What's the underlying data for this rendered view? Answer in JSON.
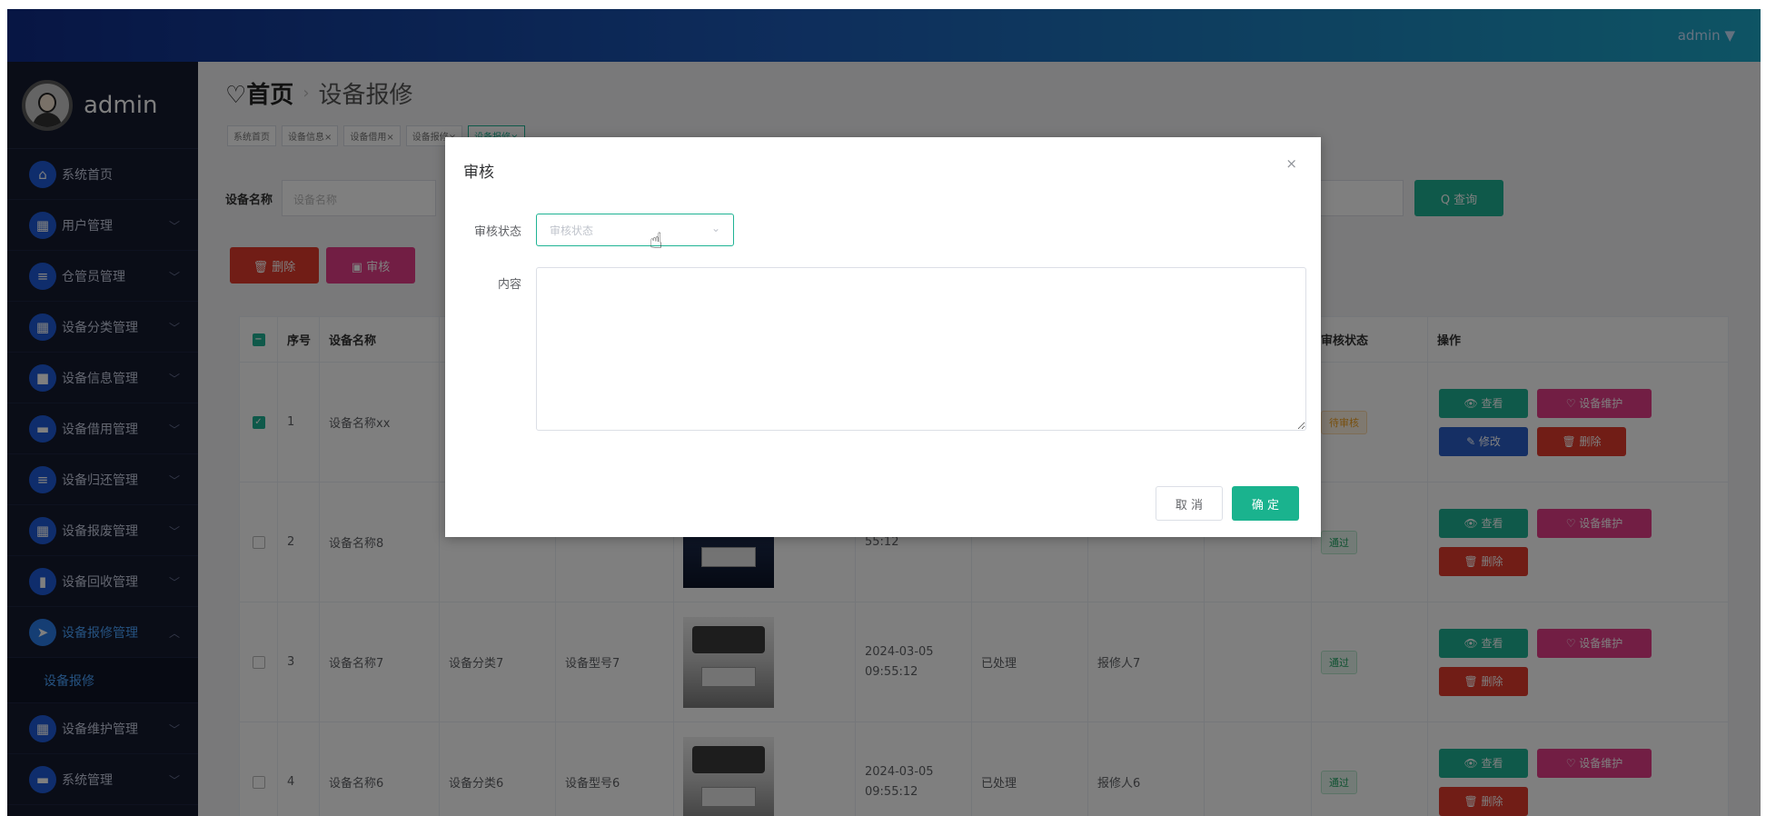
{
  "header": {
    "user_label": "admin ▼"
  },
  "sidebar": {
    "username": "admin",
    "items": [
      {
        "label": "系统首页",
        "icon": "home-icon",
        "glyph": "⌂",
        "expandable": false
      },
      {
        "label": "用户管理",
        "icon": "grid-icon",
        "glyph": "▦",
        "expandable": true
      },
      {
        "label": "仓管员管理",
        "icon": "list-icon",
        "glyph": "≡",
        "expandable": true
      },
      {
        "label": "设备分类管理",
        "icon": "grid-icon",
        "glyph": "▦",
        "expandable": true
      },
      {
        "label": "设备信息管理",
        "icon": "device-icon",
        "glyph": "■",
        "expandable": true
      },
      {
        "label": "设备借用管理",
        "icon": "monitor-icon",
        "glyph": "▬",
        "expandable": true
      },
      {
        "label": "设备归还管理",
        "icon": "list-icon",
        "glyph": "≡",
        "expandable": true
      },
      {
        "label": "设备报废管理",
        "icon": "grid-icon",
        "glyph": "▦",
        "expandable": true
      },
      {
        "label": "设备回收管理",
        "icon": "chart-icon",
        "glyph": "▮",
        "expandable": true
      },
      {
        "label": "设备报修管理",
        "icon": "send-icon",
        "glyph": "➤",
        "expandable": true,
        "active": true
      },
      {
        "label": "设备维护管理",
        "icon": "grid-icon",
        "glyph": "▦",
        "expandable": true
      },
      {
        "label": "系统管理",
        "icon": "monitor-icon",
        "glyph": "▬",
        "expandable": true
      }
    ],
    "subitem": "设备报修"
  },
  "breadcrumb": {
    "home": "♡首页",
    "sep": "›",
    "current": "设备报修"
  },
  "tabs": [
    "系统首页",
    "设备信息×",
    "设备借用×",
    "设备报修×",
    "设备报修×"
  ],
  "search": {
    "label": "设备名称",
    "placeholder": "设备名称",
    "query_label": "Q 查询"
  },
  "actions": {
    "delete_label": "🗑 删除",
    "audit_label": "▣ 审核"
  },
  "table": {
    "headers": {
      "index": "序号",
      "name": "设备名称",
      "status": "审核状态",
      "ops": "操作"
    },
    "rows": [
      {
        "index": "1",
        "name": "设备名称xx",
        "category": "",
        "model": "",
        "time": "",
        "state": "",
        "person": "",
        "audit": "待审核",
        "audit_type": "pending",
        "checked": true
      },
      {
        "index": "2",
        "name": "设备名称8",
        "category": "",
        "model": "",
        "time": "55:12",
        "state": "",
        "person": "",
        "audit": "通过",
        "audit_type": "pass",
        "checked": false
      },
      {
        "index": "3",
        "name": "设备名称7",
        "category": "设备分类7",
        "model": "设备型号7",
        "time": "2024-03-05 09:55:12",
        "state": "已处理",
        "person": "报修人7",
        "audit": "通过",
        "audit_type": "pass",
        "checked": false
      },
      {
        "index": "4",
        "name": "设备名称6",
        "category": "设备分类6",
        "model": "设备型号6",
        "time": "2024-03-05 09:55:12",
        "state": "已处理",
        "person": "报修人6",
        "audit": "通过",
        "audit_type": "pass",
        "checked": false
      }
    ],
    "ops": {
      "view": "👁 查看",
      "maint": "♡ 设备维护",
      "edit": "✎ 修改",
      "del": "🗑 删除"
    }
  },
  "dialog": {
    "title": "审核",
    "close": "×",
    "status_label": "审核状态",
    "status_placeholder": "审核状态",
    "content_label": "内容",
    "cancel": "取 消",
    "confirm": "确 定"
  }
}
